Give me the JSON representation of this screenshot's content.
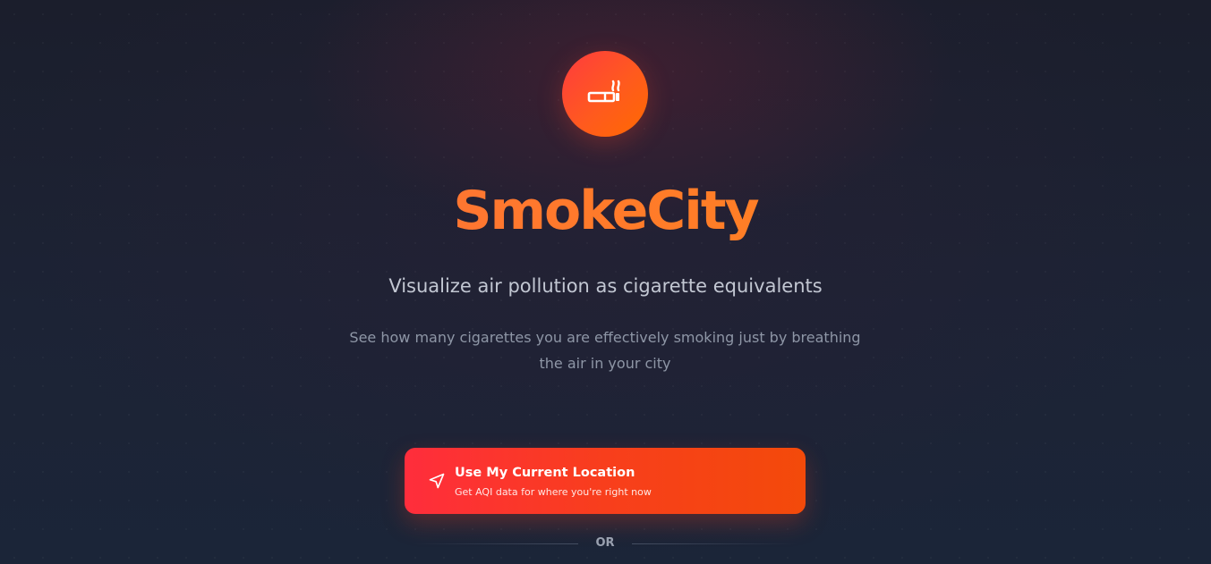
{
  "app": {
    "title": "SmokeCity",
    "subtitle": "Visualize air pollution as cigarette equivalents",
    "description": "See how many cigarettes you are effectively smoking just by breathing the air in your city"
  },
  "logo": {
    "icon": "cigarette-icon",
    "color_from": "#ff3b3f",
    "color_to": "#ff6a00"
  },
  "location_button": {
    "label": "Use My Current Location",
    "sublabel": "Get AQI data for where you're right now",
    "icon": "navigation-arrow-icon"
  },
  "divider": {
    "text": "OR"
  },
  "colors": {
    "background": "#1a2233",
    "accent": "#ff6a1e",
    "button": "#f83e1c"
  }
}
